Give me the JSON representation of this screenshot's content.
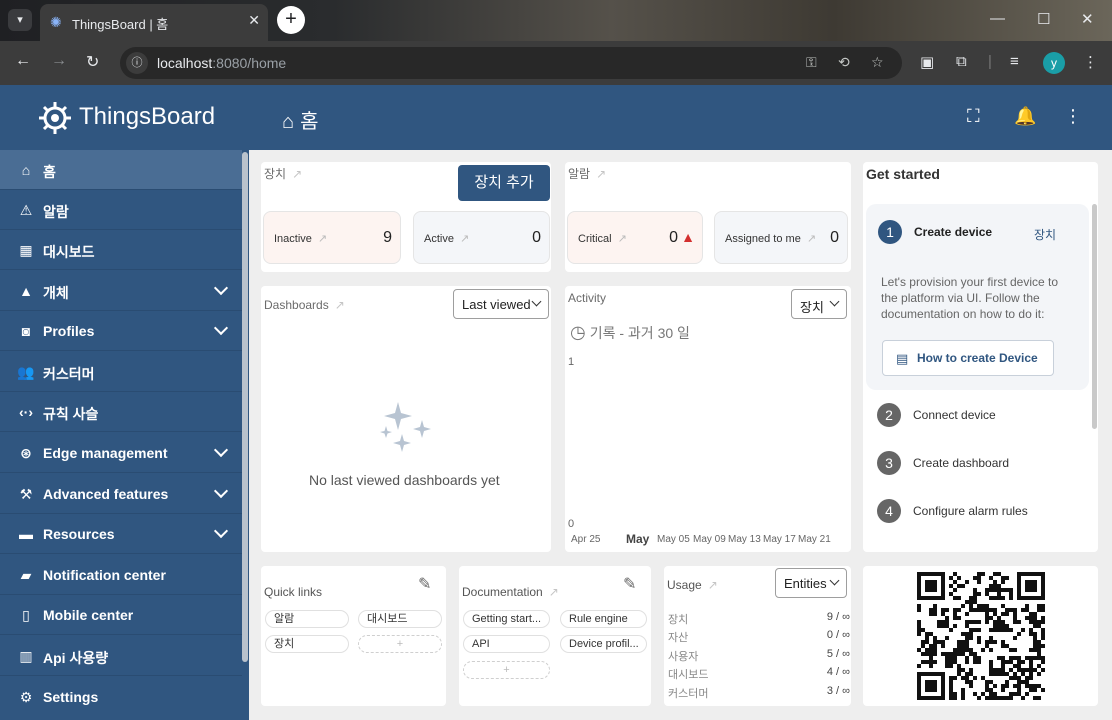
{
  "browser": {
    "tab_title": "ThingsBoard | 홈",
    "url_host": "localhost",
    "url_path": ":8080/home",
    "profile_initial": "y"
  },
  "app": {
    "brand": "ThingsBoard",
    "page_title": "홈"
  },
  "sidebar": {
    "items": [
      {
        "label": "홈",
        "icon": "home-icon",
        "active": true,
        "expandable": false
      },
      {
        "label": "알람",
        "icon": "warning-icon",
        "active": false,
        "expandable": false
      },
      {
        "label": "대시보드",
        "icon": "dashboard-icon",
        "active": false,
        "expandable": false
      },
      {
        "label": "개체",
        "icon": "entities-icon",
        "active": false,
        "expandable": true
      },
      {
        "label": "Profiles",
        "icon": "profiles-icon",
        "active": false,
        "expandable": true
      },
      {
        "label": "커스터머",
        "icon": "customers-icon",
        "active": false,
        "expandable": false
      },
      {
        "label": "규칙 사슬",
        "icon": "rule-chain-icon",
        "active": false,
        "expandable": false
      },
      {
        "label": "Edge management",
        "icon": "edge-icon",
        "active": false,
        "expandable": true
      },
      {
        "label": "Advanced features",
        "icon": "tools-icon",
        "active": false,
        "expandable": true
      },
      {
        "label": "Resources",
        "icon": "folder-icon",
        "active": false,
        "expandable": true
      },
      {
        "label": "Notification center",
        "icon": "notification-icon",
        "active": false,
        "expandable": false
      },
      {
        "label": "Mobile center",
        "icon": "mobile-icon",
        "active": false,
        "expandable": false
      },
      {
        "label": "Api 사용량",
        "icon": "chart-icon",
        "active": false,
        "expandable": false
      },
      {
        "label": "Settings",
        "icon": "gear-icon",
        "active": false,
        "expandable": false
      }
    ]
  },
  "devices": {
    "title": "장치",
    "add_button": "장치 추가",
    "inactive_label": "Inactive",
    "inactive_value": "9",
    "active_label": "Active",
    "active_value": "0"
  },
  "alarms": {
    "title": "알람",
    "critical_label": "Critical",
    "critical_value": "0",
    "assigned_label": "Assigned to me",
    "assigned_value": "0"
  },
  "dashboards": {
    "title": "Dashboards",
    "sort_select": "Last viewed",
    "empty_text": "No last viewed dashboards yet"
  },
  "activity": {
    "title": "Activity",
    "select": "장치",
    "period": "기록 - 과거 30 일",
    "y_top": "1",
    "y_bottom": "0",
    "x_ticks": [
      "Apr 25",
      "May",
      "May 05",
      "May 09",
      "May 13",
      "May 17",
      "May 21"
    ]
  },
  "get_started": {
    "title": "Get started",
    "steps": [
      {
        "num": "1",
        "label": "Create device"
      },
      {
        "num": "2",
        "label": "Connect device"
      },
      {
        "num": "3",
        "label": "Create dashboard"
      },
      {
        "num": "4",
        "label": "Configure alarm rules"
      }
    ],
    "step1_tag": "장치",
    "step1_desc": "Let's provision your first device to the platform via UI. Follow the documentation on how to do it:",
    "step1_button": "How to create Device"
  },
  "quick_links": {
    "title": "Quick links",
    "links": [
      "알람",
      "대시보드",
      "장치"
    ],
    "add": "+"
  },
  "documentation": {
    "title": "Documentation",
    "links": [
      "Getting start...",
      "Rule engine",
      "API",
      "Device profil..."
    ],
    "add": "+"
  },
  "usage": {
    "title": "Usage",
    "select": "Entities",
    "rows": [
      {
        "label": "장치",
        "value": "9 / ∞"
      },
      {
        "label": "자산",
        "value": "0 / ∞"
      },
      {
        "label": "사용자",
        "value": "5 / ∞"
      },
      {
        "label": "대시보드",
        "value": "4 / ∞"
      },
      {
        "label": "커스터머",
        "value": "3 / ∞"
      }
    ]
  }
}
